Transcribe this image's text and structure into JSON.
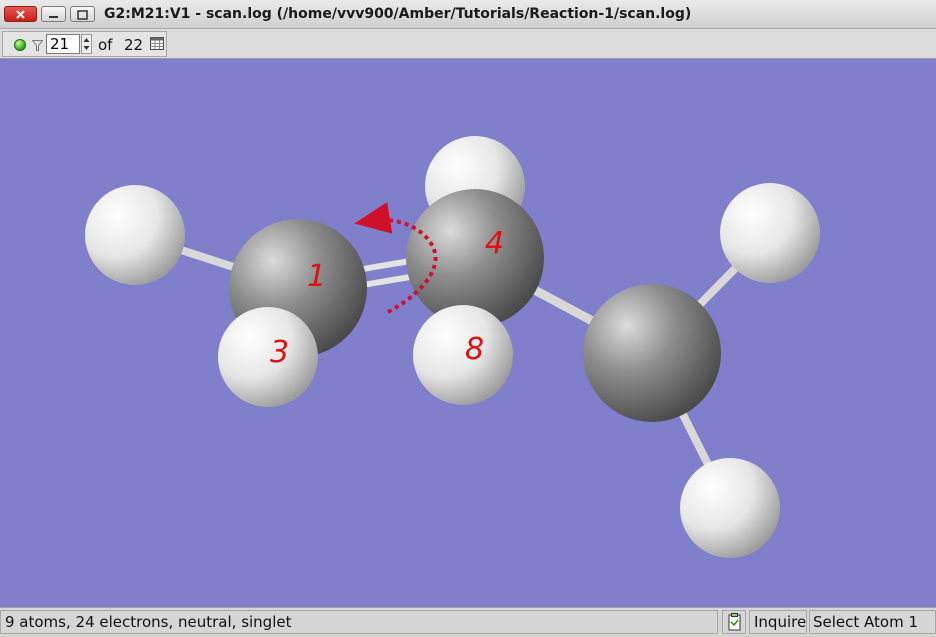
{
  "window": {
    "title": "G2:M21:V1 - scan.log (/home/vvv900/Amber/Tutorials/Reaction-1/scan.log)"
  },
  "toolbar": {
    "frame_value": "21",
    "of_label": "of",
    "frame_total": "22"
  },
  "molecule": {
    "atom_labels": [
      "1",
      "4",
      "3",
      "8"
    ]
  },
  "status": {
    "info": "9 atoms, 24 electrons, neutral, singlet",
    "mode": "Inquire",
    "selection": "Select Atom 1"
  },
  "colors": {
    "viewport_background": "#7f7fcb",
    "carbon": "#8a8a8a",
    "hydrogen": "#e6e6e6",
    "label": "#e01010",
    "close_button": "#d23a31"
  },
  "icons": [
    "close-icon",
    "minimize-icon",
    "maximize-icon",
    "green-status-icon",
    "filter-icon",
    "spinner-up-icon",
    "spinner-down-icon",
    "table-icon",
    "clipboard-icon"
  ]
}
